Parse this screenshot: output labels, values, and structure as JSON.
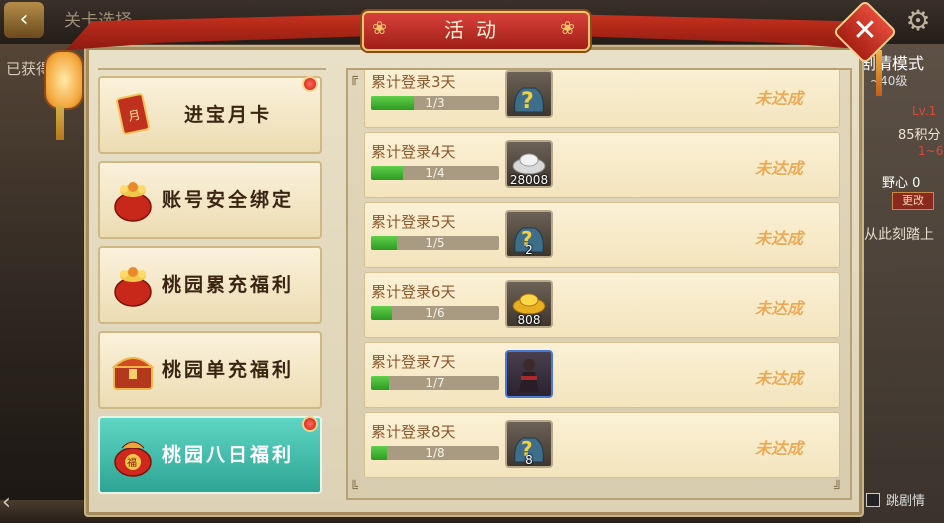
{
  "background": {
    "top_title": "关卡选择",
    "left_label": "已获得",
    "mode_title": "剧情模式",
    "mode_sub": "~40级",
    "level": "Lv.1",
    "score": "85积分",
    "range": "1~6",
    "ambition": "野心 0",
    "change_btn": "更改",
    "story_text": "从此刻踏上",
    "skip_label": "跳剧情"
  },
  "dialog": {
    "title": "活动"
  },
  "tabs": [
    {
      "label": "进宝月卡",
      "icon": "month-card-icon",
      "has_dot": true,
      "active": false
    },
    {
      "label": "账号安全绑定",
      "icon": "lucky-bag-icon",
      "has_dot": false,
      "active": false
    },
    {
      "label": "桃园累充福利",
      "icon": "lucky-bag-icon",
      "has_dot": false,
      "active": false
    },
    {
      "label": "桃园单充福利",
      "icon": "treasure-chest-icon",
      "has_dot": false,
      "active": false
    },
    {
      "label": "桃园八日福利",
      "icon": "fortune-bag-icon",
      "has_dot": true,
      "active": true
    }
  ],
  "rows": [
    {
      "title": "累计登录3天",
      "progress_text": "1/3",
      "progress": 0.333,
      "item_icon": "mystery-bag-icon",
      "qty": "",
      "status": "未达成"
    },
    {
      "title": "累计登录4天",
      "progress_text": "1/4",
      "progress": 0.25,
      "item_icon": "silver-ingot-icon",
      "qty": "28008",
      "status": "未达成"
    },
    {
      "title": "累计登录5天",
      "progress_text": "1/5",
      "progress": 0.2,
      "item_icon": "mystery-bag-icon",
      "qty": "2",
      "status": "未达成"
    },
    {
      "title": "累计登录6天",
      "progress_text": "1/6",
      "progress": 0.167,
      "item_icon": "gold-ingot-icon",
      "qty": "808",
      "status": "未达成"
    },
    {
      "title": "累计登录7天",
      "progress_text": "1/7",
      "progress": 0.143,
      "item_icon": "general-portrait-icon",
      "qty": "",
      "status": "未达成"
    },
    {
      "title": "累计登录8天",
      "progress_text": "1/8",
      "progress": 0.125,
      "item_icon": "mystery-bag-icon",
      "qty": "8",
      "status": "未达成"
    }
  ],
  "colors": {
    "progress_fill": "#3fb52e",
    "status_text": "#f0a850",
    "active_tab": "#3fbcaa",
    "title_plate": "#c0302a"
  }
}
